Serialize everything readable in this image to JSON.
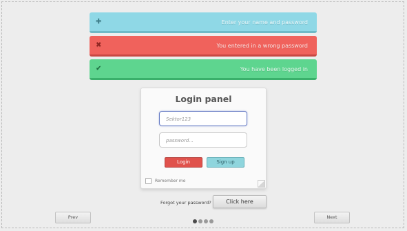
{
  "banners": {
    "info": {
      "icon": "plus-icon",
      "glyph": "✚",
      "message": "Enter your name and password"
    },
    "error": {
      "icon": "close-icon",
      "glyph": "✖",
      "message": "You entered in a wrong password"
    },
    "success": {
      "icon": "check-icon",
      "glyph": "✔",
      "message": "You have been logged in"
    }
  },
  "panel": {
    "title": "Login panel",
    "username_value": "Sektor123",
    "password_placeholder": "password...",
    "login_label": "Login",
    "signup_label": "Sign up",
    "remember_label": "Remember me"
  },
  "footer": {
    "forgot_text": "Forgot your password?",
    "click_here_label": "Click here",
    "prev_label": "Prev",
    "next_label": "Next"
  },
  "pagination": {
    "total": 4,
    "active_index": 0
  },
  "colors": {
    "info": "#8fd8e6",
    "error": "#f0625c",
    "success": "#5ed58f",
    "login_button": "#e0524c",
    "signup_button": "#8fd5dd"
  }
}
